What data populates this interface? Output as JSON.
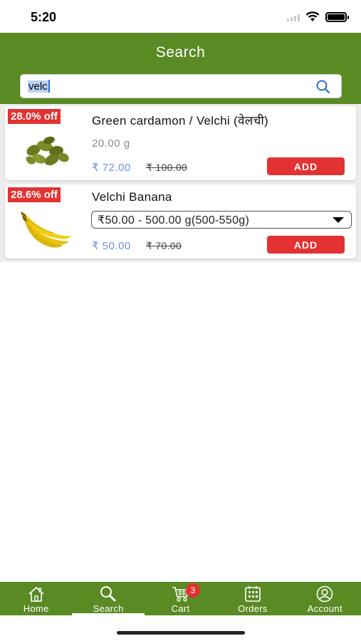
{
  "status_bar": {
    "time": "5:20"
  },
  "header": {
    "title": "Search"
  },
  "search": {
    "value": "velc",
    "icon": "search-icon"
  },
  "products": [
    {
      "discount": "28.0% off",
      "name": "Green cardamon / Velchi (वेलची)",
      "weight": "20.00 g",
      "price": "₹ 72.00",
      "mrp": "₹ 100.00",
      "add_label": "ADD"
    },
    {
      "discount": "28.6% off",
      "name": "Velchi Banana",
      "variant": "₹50.00 - 500.00 g(500-550g)",
      "price": "₹ 50.00",
      "mrp": "₹ 70.00",
      "add_label": "ADD"
    }
  ],
  "nav": {
    "items": [
      {
        "label": "Home",
        "icon": "home-icon"
      },
      {
        "label": "Search",
        "icon": "search-icon"
      },
      {
        "label": "Cart",
        "icon": "cart-icon"
      },
      {
        "label": "Orders",
        "icon": "orders-icon"
      },
      {
        "label": "Account",
        "icon": "account-icon"
      }
    ],
    "active": "Search",
    "cart_count": "3"
  },
  "colors": {
    "brand": "#5a8a24",
    "accent": "#e33232",
    "price": "#6f8fde"
  }
}
